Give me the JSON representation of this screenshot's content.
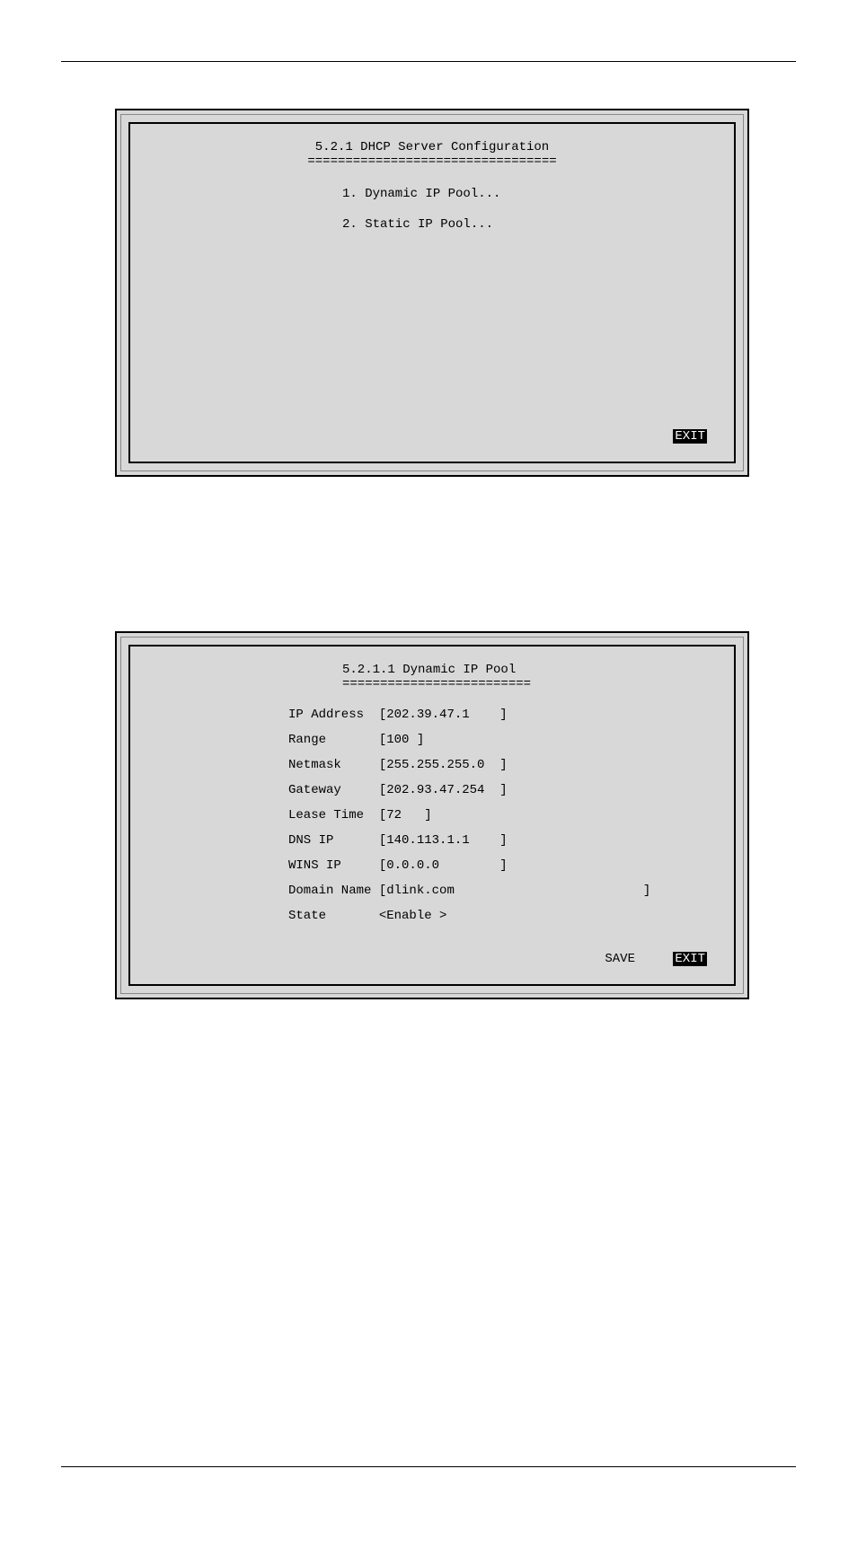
{
  "panel1": {
    "title": "5.2.1 DHCP Server Configuration",
    "rule": "=================================",
    "items": [
      "1. Dynamic IP Pool...",
      "2. Static IP Pool..."
    ],
    "exit_label": "EXIT"
  },
  "panel2": {
    "title": "5.2.1.1 Dynamic IP Pool",
    "rule": "=========================",
    "fields": {
      "ip_address": {
        "label": "IP Address",
        "value": "202.39.47.1",
        "width": 15
      },
      "range": {
        "label": "Range",
        "value": "100",
        "width": 4
      },
      "netmask": {
        "label": "Netmask",
        "value": "255.255.255.0",
        "width": 15
      },
      "gateway": {
        "label": "Gateway",
        "value": "202.93.47.254",
        "width": 15
      },
      "lease_time": {
        "label": "Lease Time",
        "value": "72",
        "width": 5
      },
      "dns_ip": {
        "label": "DNS IP",
        "value": "140.113.1.1",
        "width": 15
      },
      "wins_ip": {
        "label": "WINS IP",
        "value": "0.0.0.0",
        "width": 15
      },
      "domain_name": {
        "label": "Domain Name",
        "value": "dlink.com",
        "width": 34
      },
      "state": {
        "label": "State",
        "value": "Enable ",
        "type": "select"
      }
    },
    "save_label": "SAVE",
    "exit_label": "EXIT"
  }
}
